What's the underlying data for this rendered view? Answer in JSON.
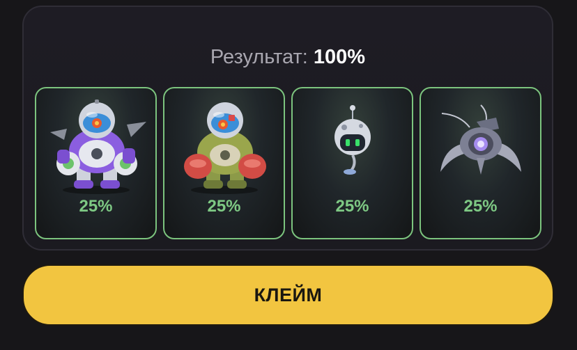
{
  "result": {
    "label": "Результат:",
    "value": "100%"
  },
  "cards": [
    {
      "name": "purple-mech-robot",
      "percent": "25%"
    },
    {
      "name": "green-red-mech-robot",
      "percent": "25%"
    },
    {
      "name": "floating-sphere-drone",
      "percent": "25%"
    },
    {
      "name": "spider-drone",
      "percent": "25%"
    }
  ],
  "claim_button": {
    "label": "КЛЕЙМ"
  },
  "colors": {
    "card_border": "#7cc47e",
    "percent_text": "#7ec984",
    "button_bg": "#f2c540",
    "page_bg": "#171619"
  }
}
